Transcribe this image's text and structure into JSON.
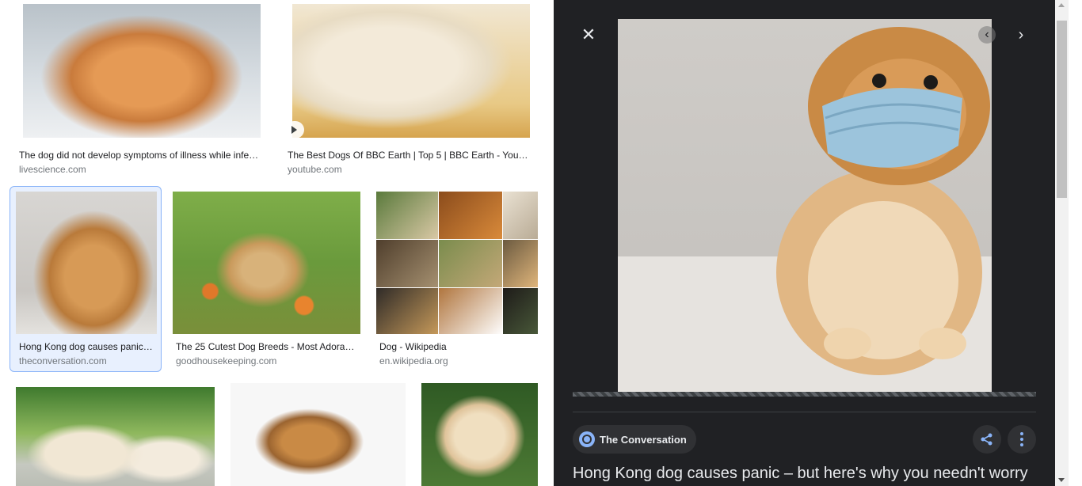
{
  "results": [
    {
      "caption": "The dog did not develop symptoms of illness while infe…",
      "source": "livescience.com"
    },
    {
      "caption": "The Best Dogs Of BBC Earth | Top 5 | BBC Earth - YouT…",
      "source": "youtube.com"
    },
    {
      "caption": "Hong Kong dog causes panic…",
      "source": "theconversation.com"
    },
    {
      "caption": "The 25 Cutest Dog Breeds - Most Adora…",
      "source": "goodhousekeeping.com"
    },
    {
      "caption": "Dog - Wikipedia",
      "source": "en.wikipedia.org"
    }
  ],
  "preview": {
    "close_icon": "✕",
    "prev_icon": "‹",
    "next_icon": "›",
    "site_name": "The Conversation",
    "title": "Hong Kong dog causes panic – but here's why you needn't worry"
  },
  "colors": {
    "panel_bg": "#202124",
    "selected_border": "#8ab4f8",
    "accent": "#8ab4f8"
  }
}
